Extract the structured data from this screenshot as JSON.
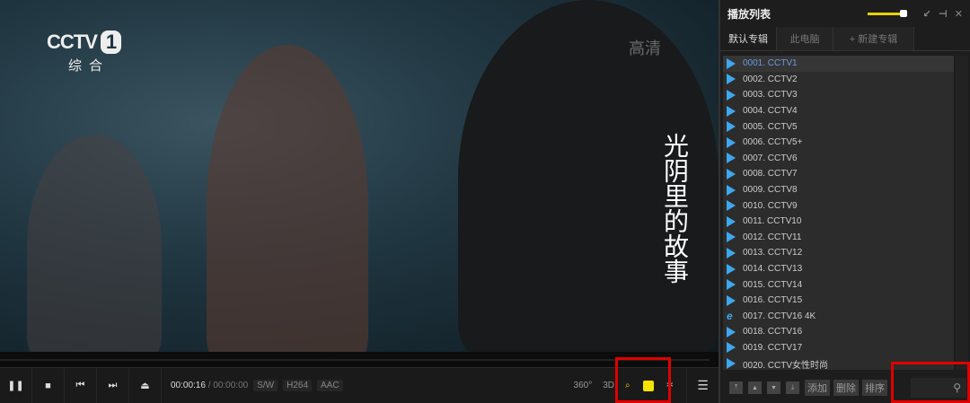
{
  "video": {
    "channel_logo": "CCTV",
    "channel_number": "1",
    "channel_sub": "综合",
    "watermark": "高清",
    "show_title": "光阴里的故事"
  },
  "controls": {
    "current_time": "00:00:16",
    "separator": "/",
    "total_time": "00:00:00",
    "tags": [
      "S/W",
      "H264",
      "AAC"
    ],
    "vr_label": "360°",
    "threed_label": "3D"
  },
  "playlist": {
    "title": "播放列表",
    "tabs": [
      "默认专辑",
      "此电脑",
      "+ 新建专辑"
    ],
    "items": [
      "0001. CCTV1",
      "0002. CCTV2",
      "0003. CCTV3",
      "0004. CCTV4",
      "0005. CCTV5",
      "0006. CCTV5+",
      "0007. CCTV6",
      "0008. CCTV7",
      "0009. CCTV8",
      "0010. CCTV9",
      "0011. CCTV10",
      "0012. CCTV11",
      "0013. CCTV12",
      "0014. CCTV13",
      "0015. CCTV14",
      "0016. CCTV15",
      "0017. CCTV16 4K",
      "0018. CCTV16",
      "0019. CCTV17",
      "0020. CCTV女性时尚"
    ],
    "footer": {
      "add": "添加",
      "delete": "删除",
      "sort": "排序"
    }
  },
  "colors": {
    "accent": "#f5e400",
    "highlight": "#e00000",
    "link": "#3ea7f0"
  }
}
